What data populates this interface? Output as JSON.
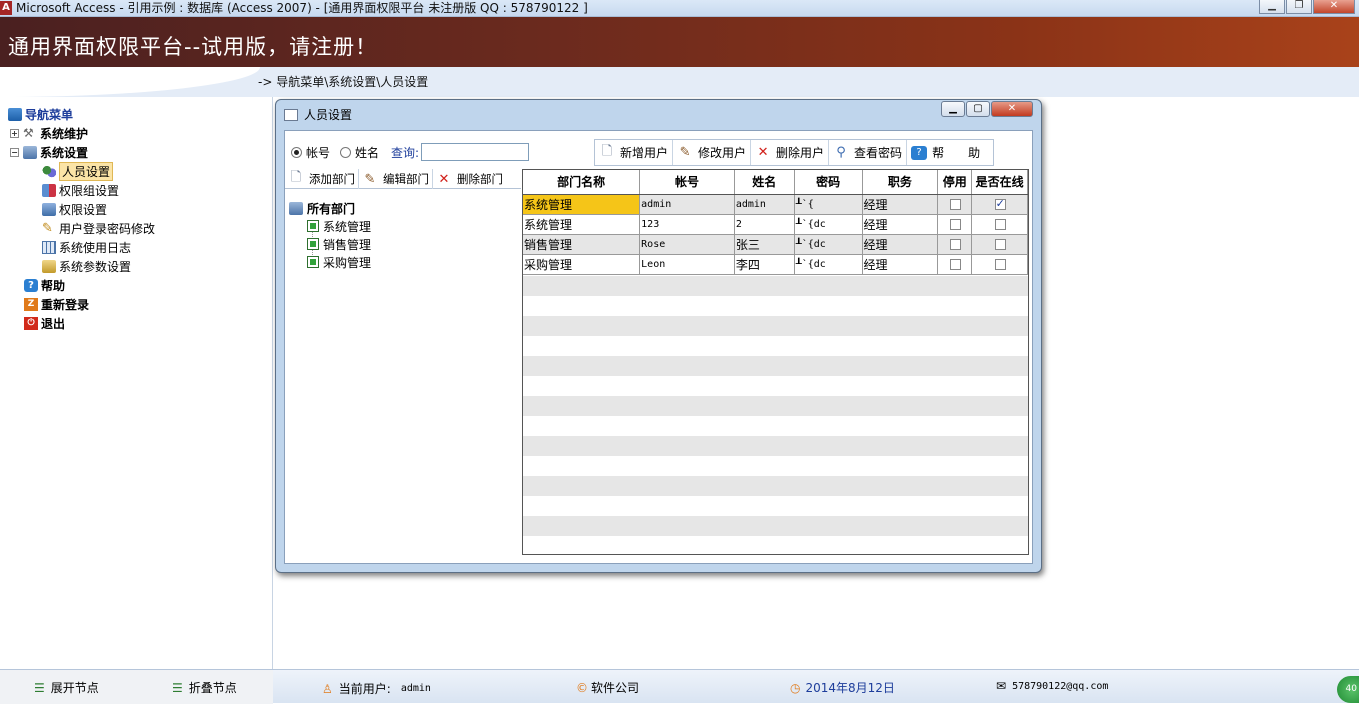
{
  "window": {
    "title": "Microsoft Access - 引用示例 : 数据库 (Access 2007) - [通用界面权限平台  未注册版 QQ : 578790122  ]",
    "app_icon": "A"
  },
  "banner": {
    "text": "通用界面权限平台--试用版，请注册！"
  },
  "breadcrumb": {
    "text": "-> 导航菜单\\系统设置\\人员设置"
  },
  "nav": {
    "root": "导航菜单",
    "items": [
      {
        "label": "系统维护",
        "expander": "+"
      },
      {
        "label": "系统设置",
        "expander": "−"
      },
      {
        "label": "人员设置"
      },
      {
        "label": "权限组设置"
      },
      {
        "label": "权限设置"
      },
      {
        "label": "用户登录密码修改"
      },
      {
        "label": "系统使用日志"
      },
      {
        "label": "系统参数设置"
      },
      {
        "label": "帮助"
      },
      {
        "label": "重新登录"
      },
      {
        "label": "退出"
      }
    ]
  },
  "statusbar": {
    "expand": "展开节点",
    "collapse": "折叠节点",
    "current_user_label": "当前用户:",
    "current_user": "admin",
    "company": "软件公司",
    "date": "2014年8月12日",
    "email": "578790122@qq.com",
    "badge": "40"
  },
  "dialog": {
    "title": "人员设置",
    "search": {
      "radio_account": "帐号",
      "radio_name": "姓名",
      "query_label": "查询:",
      "query_value": ""
    },
    "user_toolbar": {
      "add": "新增用户",
      "edit": "修改用户",
      "delete": "删除用户",
      "view_pwd": "查看密码",
      "help": "帮　　助"
    },
    "dept_toolbar": {
      "add": "添加部门",
      "edit": "编辑部门",
      "delete": "删除部门"
    },
    "tree": {
      "root": "所有部门",
      "children": [
        "系统管理",
        "销售管理",
        "采购管理"
      ]
    },
    "grid": {
      "columns": [
        "部门名称",
        "帐号",
        "姓名",
        "密码",
        "职务",
        "停用",
        "是否在线"
      ],
      "rows": [
        {
          "dept": "系统管理",
          "account": "admin",
          "name": "admin",
          "password": "┸`{",
          "title": "经理",
          "disabled": false,
          "online": true
        },
        {
          "dept": "系统管理",
          "account": "123",
          "name": "2",
          "password": "┸`{dc",
          "title": "经理",
          "disabled": false,
          "online": false
        },
        {
          "dept": "销售管理",
          "account": "Rose",
          "name": "张三",
          "password": "┸`{dc",
          "title": "经理",
          "disabled": false,
          "online": false
        },
        {
          "dept": "采购管理",
          "account": "Leon",
          "name": "李四",
          "password": "┸`{dc",
          "title": "经理",
          "disabled": false,
          "online": false
        }
      ]
    }
  }
}
